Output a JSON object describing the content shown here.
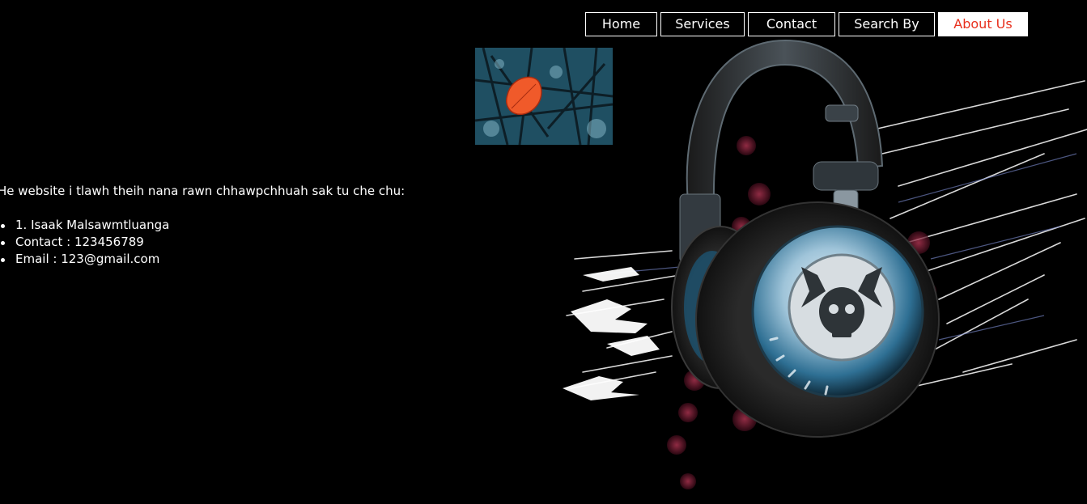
{
  "nav": {
    "items": [
      {
        "label": "Home"
      },
      {
        "label": "Services"
      },
      {
        "label": "Contact"
      },
      {
        "label": "Search By"
      },
      {
        "label": "About Us"
      }
    ],
    "active_index": 4,
    "active_text_color": "#e8311e"
  },
  "thumbnail": {
    "icon": "red-leaf-photo"
  },
  "background_art": {
    "icon": "headphones-skull-illustration"
  },
  "content": {
    "intro": "He website i tlawh theih nana rawn chhawpchhuah sak tu che chu:",
    "members": [
      "1. Isaak Malsawmtluanga",
      "Contact : 123456789",
      "Email : 123@gmail.com"
    ]
  }
}
